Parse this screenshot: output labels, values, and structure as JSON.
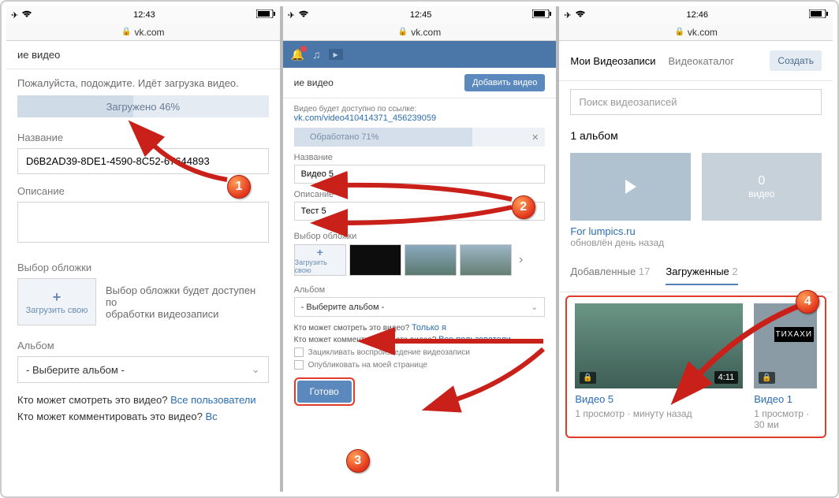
{
  "phone1": {
    "status_time": "12:43",
    "url": "vk.com",
    "header_partial": "ие видео",
    "wait_text": "Пожалуйста, подождите. Идёт загрузка видео.",
    "progress_text": "Загружено 46%",
    "progress_pct": 46,
    "title_label": "Название",
    "title_value": "D6B2AD39-8DE1-4590-8C52-67644893",
    "desc_label": "Описание",
    "cover_label": "Выбор обложки",
    "upload_cover": "Загрузить свою",
    "cover_hint": "Выбор обложки будет доступен после обработки видеозаписи",
    "cover_hint_l1": "Выбор обложки будет доступен по",
    "cover_hint_l2": "обработки видеозаписи",
    "album_label": "Альбом",
    "album_placeholder": "- Выберите альбом -",
    "who_view": "Кто может смотреть это видео?",
    "who_comment": "Кто может комментировать это видео?",
    "all_users": "Все пользователи",
    "all_short": "Вс"
  },
  "phone2": {
    "status_time": "12:45",
    "url": "vk.com",
    "header_partial": "ие видео",
    "add_video_btn": "Добавить видео",
    "link_hint": "Видео будет доступно по ссылке:",
    "link_url": "vk.com/video410414371_456239059",
    "progress_text": "Обработано 71%",
    "progress_pct": 71,
    "title_label": "Название",
    "title_value": "Видео 5",
    "desc_label": "Описание",
    "desc_value": "Тест 5",
    "cover_label": "Выбор обложки",
    "upload_cover": "Загрузить свою",
    "album_label": "Альбом",
    "album_placeholder": "- Выберите альбом -",
    "who_view": "Кто может смотреть это видео?",
    "who_view_val": "Только я",
    "who_comment": "Кто может комментировать это видео?",
    "who_comment_val": "Все пользователи",
    "loop_check": "Зацикливать воспроизведение видеозаписи",
    "publish_check": "Опубликовать на моей странице",
    "done_btn": "Готово"
  },
  "phone3": {
    "status_time": "12:46",
    "url": "vk.com",
    "tab_my": "Мои Видеозаписи",
    "tab_catalog": "Видеокаталог",
    "create_btn": "Создать",
    "search_placeholder": "Поиск видеозаписей",
    "albums_count": "1 альбом",
    "album_zero_count": "0",
    "album_zero_label": "видео",
    "album_name": "For lumpics.ru",
    "album_updated": "обновлён день назад",
    "tab_added": "Добавленные",
    "tab_added_count": "17",
    "tab_uploaded": "Загруженные",
    "tab_uploaded_count": "2",
    "video1_title": "Видео 5",
    "video1_duration": "4:11",
    "video1_meta": "1 просмотр · минуту назад",
    "video2_title": "Видео 1",
    "video2_meta": "1 просмотр · 30 ми",
    "video2_overlay": "ТИХАХИ"
  },
  "annotations": {
    "b1": "1",
    "b2": "2",
    "b3": "3",
    "b4": "4"
  }
}
